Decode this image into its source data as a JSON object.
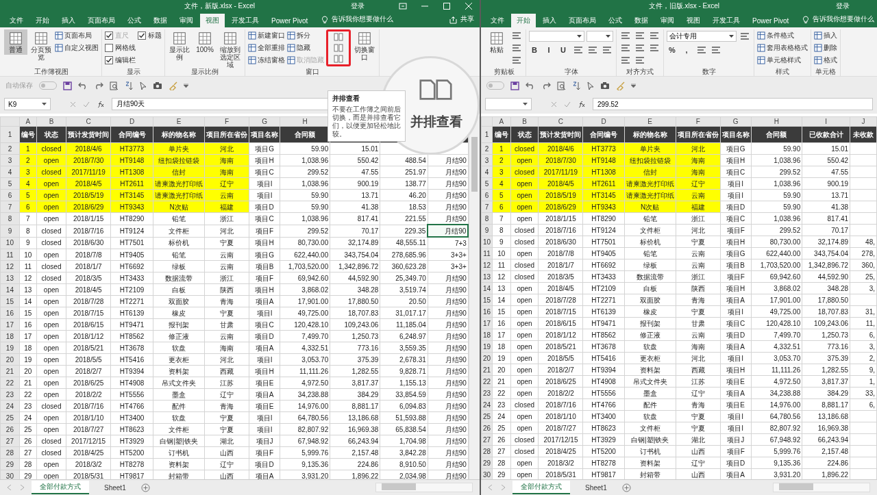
{
  "windows": [
    {
      "title": "文件，新版.xlsx  -  Excel",
      "sign_in": "登录",
      "window_controls": true,
      "tabs": [
        {
          "label": "文件",
          "selected": false
        },
        {
          "label": "开始",
          "selected": false
        },
        {
          "label": "插入",
          "selected": false
        },
        {
          "label": "页面布局",
          "selected": false
        },
        {
          "label": "公式",
          "selected": false
        },
        {
          "label": "数据",
          "selected": false
        },
        {
          "label": "审阅",
          "selected": false
        },
        {
          "label": "视图",
          "selected": true
        },
        {
          "label": "开发工具",
          "selected": false
        },
        {
          "label": "Power Pivot",
          "selected": false
        }
      ],
      "tell_me": "告诉我你想要做什么",
      "share": "共享",
      "ribbon": {
        "kind": "view",
        "groups": [
          {
            "label": "工作簿视图",
            "items": [
              {
                "kind": "large",
                "label": "普通",
                "selected": true
              },
              {
                "kind": "large",
                "label": "分页预览",
                "selected": false
              },
              {
                "kind": "small",
                "label": "页面布局",
                "disabled": false
              },
              {
                "kind": "small",
                "label": "自定义视图",
                "disabled": false
              }
            ]
          },
          {
            "label": "显示",
            "items": [
              {
                "kind": "check",
                "label": "直尺",
                "checked": true,
                "disabled": true
              },
              {
                "kind": "check",
                "label": "网格线",
                "checked": false,
                "disabled": false
              },
              {
                "kind": "check",
                "label": "编辑栏",
                "checked": true,
                "disabled": false
              },
              {
                "kind": "check",
                "label": "标题",
                "checked": true,
                "disabled": false
              }
            ]
          },
          {
            "label": "显示比例",
            "items": [
              {
                "kind": "large",
                "label": "显示比例"
              },
              {
                "kind": "large",
                "label": "100%"
              },
              {
                "kind": "large",
                "label": "缩放到选定区域"
              }
            ]
          },
          {
            "label": "窗口",
            "items": [
              {
                "kind": "small",
                "label": "新建窗口",
                "disabled": false
              },
              {
                "kind": "small",
                "label": "全部重排",
                "disabled": false
              },
              {
                "kind": "small",
                "label": "冻结窗格",
                "disabled": false
              },
              {
                "kind": "small",
                "label": "拆分",
                "disabled": false
              },
              {
                "kind": "small",
                "label": "隐藏",
                "disabled": false
              },
              {
                "kind": "small",
                "label": "取消隐藏",
                "disabled": true
              },
              {
                "kind": "stack",
                "framed": true,
                "items": [
                  {
                    "kind": "icon"
                  },
                  {
                    "kind": "icon"
                  },
                  {
                    "kind": "icon"
                  }
                ]
              },
              {
                "kind": "large",
                "label": "切换窗口"
              }
            ]
          }
        ]
      },
      "quick_access": {
        "autosave": "自动保存",
        "autosave_on": false
      },
      "name_box": "K9",
      "formula": "月结90天",
      "sheet": {
        "columns": [
          "A",
          "B",
          "C",
          "D",
          "E",
          "F",
          "G",
          "H"
        ],
        "header_row": "1",
        "headers": [
          "编号",
          "状态",
          "预计发货时间",
          "合同编号",
          "标的物名称",
          "项目所在省份",
          "项目名称",
          "合同额"
        ],
        "rows": [
          {
            "row": "2",
            "highlight": true,
            "selected": false,
            "cells": [
              "1",
              "closed",
              "2018/4/6",
              "HT3773",
              "单片夹",
              "河北",
              "项目G",
              "59.90",
              "15.01"
            ]
          },
          {
            "row": "3",
            "highlight": true,
            "selected": false,
            "cells": [
              "2",
              "open",
              "2018/7/30",
              "HT9148",
              "纽扣袋拉链袋",
              "海南",
              "项目H",
              "1,038.96",
              "550.42",
              "488.54",
              "月结90"
            ]
          },
          {
            "row": "4",
            "highlight": true,
            "selected": false,
            "cells": [
              "3",
              "closed",
              "2017/11/19",
              "HT1308",
              "信封",
              "海南",
              "项目C",
              "299.52",
              "47.55",
              "251.97",
              "月结90"
            ]
          },
          {
            "row": "5",
            "highlight": true,
            "selected": false,
            "cells": [
              "4",
              "open",
              "2018/4/5",
              "HT2611",
              "请柬激光打印纸",
              "辽宁",
              "项目I",
              "1,038.96",
              "900.19",
              "138.77",
              "月结90"
            ]
          },
          {
            "row": "6",
            "highlight": true,
            "selected": false,
            "cells": [
              "5",
              "open",
              "2018/5/19",
              "HT3145",
              "请柬激光打印纸",
              "云南",
              "项目I",
              "59.90",
              "13.71",
              "46.20",
              "月结90"
            ]
          },
          {
            "row": "7",
            "highlight": true,
            "selected": false,
            "cells": [
              "6",
              "open",
              "2018/6/29",
              "HT9343",
              "N次贴",
              "福建",
              "项目D",
              "59.90",
              "41.38",
              "18.53",
              "月结90"
            ]
          },
          {
            "row": "8",
            "highlight": false,
            "selected": false,
            "cells": [
              "7",
              "open",
              "2018/1/15",
              "HT8290",
              "铅笔",
              "浙江",
              "项目C",
              "1,038.96",
              "817.41",
              "221.55",
              "月结90"
            ]
          },
          {
            "row": "9",
            "highlight": false,
            "selected": true,
            "cells": [
              "8",
              "closed",
              "2018/7/16",
              "HT9124",
              "文件柜",
              "河北",
              "项目F",
              "299.52",
              "70.17",
              "229.35",
              "月结90"
            ]
          },
          {
            "row": "10",
            "highlight": false,
            "selected": false,
            "cells": [
              "9",
              "closed",
              "2018/6/30",
              "HT7501",
              "标价机",
              "宁夏",
              "项目H",
              "80,730.00",
              "32,174.89",
              "48,555.11",
              "7+3"
            ]
          },
          {
            "row": "11",
            "highlight": false,
            "selected": false,
            "cells": [
              "10",
              "open",
              "2018/7/8",
              "HT9405",
              "铅笔",
              "云南",
              "项目G",
              "622,440.00",
              "343,754.04",
              "278,685.96",
              "3+3+"
            ]
          },
          {
            "row": "12",
            "highlight": false,
            "selected": false,
            "cells": [
              "11",
              "closed",
              "2018/1/7",
              "HT6692",
              "绿板",
              "云南",
              "项目B",
              "1,703,520.00",
              "1,342,896.72",
              "360,623.28",
              "3+3+"
            ]
          },
          {
            "row": "13",
            "highlight": false,
            "selected": false,
            "cells": [
              "12",
              "closed",
              "2018/3/5",
              "HT3433",
              "数据流带",
              "浙江",
              "项目F",
              "69,942.60",
              "44,592.90",
              "25,349.70",
              "月结90"
            ]
          },
          {
            "row": "14",
            "highlight": false,
            "selected": false,
            "cells": [
              "13",
              "open",
              "2018/4/5",
              "HT2109",
              "白板",
              "陕西",
              "项目H",
              "3,868.02",
              "348.28",
              "3,519.74",
              "月结90"
            ]
          },
          {
            "row": "15",
            "highlight": false,
            "selected": false,
            "cells": [
              "14",
              "open",
              "2018/7/28",
              "HT2271",
              "双面胶",
              "青海",
              "项目A",
              "17,901.00",
              "17,880.50",
              "20.50",
              "月结90"
            ]
          },
          {
            "row": "16",
            "highlight": false,
            "selected": false,
            "cells": [
              "15",
              "open",
              "2018/7/15",
              "HT6139",
              "橡皮",
              "宁夏",
              "项目I",
              "49,725.00",
              "18,707.83",
              "31,017.17",
              "月结90"
            ]
          },
          {
            "row": "17",
            "highlight": false,
            "selected": false,
            "cells": [
              "16",
              "open",
              "2018/6/15",
              "HT9471",
              "报刊架",
              "甘肃",
              "项目C",
              "120,428.10",
              "109,243.06",
              "11,185.04",
              "月结90"
            ]
          },
          {
            "row": "18",
            "highlight": false,
            "selected": false,
            "cells": [
              "17",
              "open",
              "2018/1/12",
              "HT8562",
              "修正液",
              "云南",
              "项目D",
              "7,499.70",
              "1,250.73",
              "6,248.97",
              "月结90"
            ]
          },
          {
            "row": "19",
            "highlight": false,
            "selected": false,
            "cells": [
              "18",
              "open",
              "2018/5/21",
              "HT3678",
              "软盘",
              "海南",
              "项目A",
              "4,332.51",
              "773.16",
              "3,559.35",
              "月结90"
            ]
          },
          {
            "row": "20",
            "highlight": false,
            "selected": false,
            "cells": [
              "19",
              "open",
              "2018/5/5",
              "HT5416",
              "更衣柜",
              "河北",
              "项目I",
              "3,053.70",
              "375.39",
              "2,678.31",
              "月结90"
            ]
          },
          {
            "row": "21",
            "highlight": false,
            "selected": false,
            "cells": [
              "20",
              "open",
              "2018/2/7",
              "HT9394",
              "资料架",
              "西藏",
              "项目H",
              "11,111.26",
              "1,282.55",
              "9,828.71",
              "月结90"
            ]
          },
          {
            "row": "22",
            "highlight": false,
            "selected": false,
            "cells": [
              "21",
              "open",
              "2018/6/25",
              "HT4908",
              "吊式文件夹",
              "江苏",
              "项目E",
              "4,972.50",
              "3,817.37",
              "1,155.13",
              "月结90"
            ]
          },
          {
            "row": "23",
            "highlight": false,
            "selected": false,
            "cells": [
              "22",
              "open",
              "2018/2/2",
              "HT5556",
              "墨盒",
              "辽宁",
              "项目A",
              "34,238.88",
              "384.29",
              "33,854.59",
              "月结90"
            ]
          },
          {
            "row": "24",
            "highlight": false,
            "selected": false,
            "cells": [
              "23",
              "closed",
              "2018/7/16",
              "HT4766",
              "配件",
              "青海",
              "项目E",
              "14,976.00",
              "8,881.17",
              "6,094.83",
              "月结90"
            ]
          },
          {
            "row": "25",
            "highlight": false,
            "selected": false,
            "cells": [
              "24",
              "open",
              "2018/1/10",
              "HT3400",
              "软盘",
              "宁夏",
              "项目I",
              "64,780.56",
              "13,186.68",
              "51,593.88",
              "月结90"
            ]
          },
          {
            "row": "26",
            "highlight": false,
            "selected": false,
            "cells": [
              "25",
              "open",
              "2018/7/27",
              "HT8623",
              "文件柜",
              "宁夏",
              "项目I",
              "82,807.92",
              "16,969.38",
              "65,838.54",
              "月结90"
            ]
          },
          {
            "row": "27",
            "highlight": false,
            "selected": false,
            "cells": [
              "26",
              "closed",
              "2017/12/15",
              "HT3929",
              "白钢|塑|铁夹",
              "湖北",
              "项目J",
              "67,948.92",
              "66,243.94",
              "1,704.98",
              "月结90"
            ]
          },
          {
            "row": "28",
            "highlight": false,
            "selected": false,
            "cells": [
              "27",
              "closed",
              "2018/4/25",
              "HT5200",
              "订书机",
              "山西",
              "项目F",
              "5,999.76",
              "2,157.48",
              "3,842.28",
              "月结90"
            ]
          },
          {
            "row": "29",
            "highlight": false,
            "selected": false,
            "cells": [
              "28",
              "open",
              "2018/3/2",
              "HT8278",
              "资料架",
              "辽宁",
              "项目D",
              "9,135.36",
              "224.86",
              "8,910.50",
              "月结90"
            ]
          },
          {
            "row": "30",
            "highlight": false,
            "selected": false,
            "cells": [
              "29",
              "open",
              "2018/5/31",
              "HT9817",
              "封箱带",
              "山西",
              "项目A",
              "3,931.20",
              "1,896.22",
              "2,034.98",
              "月结90"
            ]
          }
        ]
      },
      "sheet_tabs": [
        {
          "label": "全部付款方式",
          "selected": true
        },
        {
          "label": "Sheet1",
          "selected": false
        }
      ]
    },
    {
      "title": "文件，旧版.xlsx  -  Excel",
      "sign_in": "登录",
      "window_controls": false,
      "tabs": [
        {
          "label": "文件",
          "selected": false
        },
        {
          "label": "开始",
          "selected": true
        },
        {
          "label": "插入",
          "selected": false
        },
        {
          "label": "页面布局",
          "selected": false
        },
        {
          "label": "公式",
          "selected": false
        },
        {
          "label": "数据",
          "selected": false
        },
        {
          "label": "审阅",
          "selected": false
        },
        {
          "label": "视图",
          "selected": false
        },
        {
          "label": "开发工具",
          "selected": false
        },
        {
          "label": "Power Pivot",
          "selected": false
        }
      ],
      "tell_me": "告诉我你想要做什么",
      "ribbon": {
        "kind": "home",
        "groups": [
          {
            "label": "剪贴板",
            "items": [
              {
                "kind": "large",
                "label": "粘贴"
              },
              {
                "kind": "icon"
              },
              {
                "kind": "icon"
              },
              {
                "kind": "icon"
              }
            ]
          },
          {
            "label": "字体",
            "items": [
              {
                "kind": "dropdown"
              },
              {
                "kind": "dropdown"
              },
              {
                "kind": "text",
                "label": "B"
              },
              {
                "kind": "text",
                "label": "I"
              },
              {
                "kind": "text",
                "label": "U"
              },
              {
                "kind": "icon"
              },
              {
                "kind": "icon"
              },
              {
                "kind": "icon"
              }
            ]
          },
          {
            "label": "对齐方式",
            "items": [
              {
                "kind": "icon"
              },
              {
                "kind": "icon"
              },
              {
                "kind": "icon"
              },
              {
                "kind": "icon"
              },
              {
                "kind": "icon"
              },
              {
                "kind": "icon"
              },
              {
                "kind": "icon"
              },
              {
                "kind": "icon"
              }
            ]
          },
          {
            "label": "数字",
            "items": [
              {
                "kind": "dropdown",
                "label": "会计专用"
              },
              {
                "kind": "icon"
              },
              {
                "kind": "text",
                "label": "%"
              },
              {
                "kind": "text",
                "label": ","
              },
              {
                "kind": "icon"
              },
              {
                "kind": "icon"
              }
            ]
          },
          {
            "label": "样式",
            "items": [
              {
                "kind": "small",
                "label": "条件格式",
                "disabled": false
              },
              {
                "kind": "small",
                "label": "套用表格格式",
                "disabled": false
              },
              {
                "kind": "small",
                "label": "单元格样式",
                "disabled": false
              }
            ]
          },
          {
            "label": "单元格",
            "items": [
              {
                "kind": "small",
                "label": "插入",
                "disabled": false
              },
              {
                "kind": "small",
                "label": "删除",
                "disabled": false
              },
              {
                "kind": "small",
                "label": "格式",
                "disabled": false
              }
            ]
          }
        ]
      },
      "quick_access": {
        "autosave_on": false
      },
      "formula": "299.52",
      "sheet": {
        "columns": [
          "A",
          "B",
          "C",
          "D",
          "E",
          "F",
          "G",
          "H",
          "I",
          "J"
        ],
        "header_row": "1",
        "headers": [
          "编号",
          "状态",
          "预计发货时间",
          "合同编号",
          "标的物名称",
          "项目所在省份",
          "项目名称",
          "合同额",
          "已收款合计",
          "未收款"
        ],
        "rows": [
          {
            "row": "2",
            "highlight": true,
            "cells": [
              "1",
              "closed",
              "2018/4/6",
              "HT3773",
              "单片夹",
              "河北",
              "项目G",
              "59.90",
              "15.01"
            ]
          },
          {
            "row": "3",
            "highlight": true,
            "cells": [
              "2",
              "open",
              "2018/7/30",
              "HT9148",
              "纽扣袋拉链袋",
              "海南",
              "项目H",
              "1,038.96",
              "550.42"
            ]
          },
          {
            "row": "4",
            "highlight": true,
            "cells": [
              "3",
              "closed",
              "2017/11/19",
              "HT1308",
              "信封",
              "海南",
              "项目C",
              "299.52",
              "47.55"
            ]
          },
          {
            "row": "5",
            "highlight": true,
            "cells": [
              "4",
              "open",
              "2018/4/5",
              "HT2611",
              "请柬激光打印纸",
              "辽宁",
              "项目I",
              "1,038.96",
              "900.19"
            ]
          },
          {
            "row": "6",
            "highlight": true,
            "cells": [
              "5",
              "open",
              "2018/5/19",
              "HT3145",
              "请柬激光打印纸",
              "云南",
              "项目I",
              "59.90",
              "13.71"
            ]
          },
          {
            "row": "7",
            "highlight": true,
            "cells": [
              "6",
              "open",
              "2018/6/29",
              "HT9343",
              "N次贴",
              "福建",
              "项目D",
              "59.90",
              "41.38"
            ]
          },
          {
            "row": "8",
            "highlight": false,
            "cells": [
              "7",
              "open",
              "2018/1/15",
              "HT8290",
              "铅笔",
              "浙江",
              "项目C",
              "1,038.96",
              "817.41"
            ]
          },
          {
            "row": "9",
            "highlight": false,
            "cells": [
              "8",
              "closed",
              "2018/7/16",
              "HT9124",
              "文件柜",
              "河北",
              "项目F",
              "299.52",
              "70.17"
            ]
          },
          {
            "row": "10",
            "highlight": false,
            "cells": [
              "9",
              "closed",
              "2018/6/30",
              "HT7501",
              "标价机",
              "宁夏",
              "项目H",
              "80,730.00",
              "32,174.89",
              "48,"
            ]
          },
          {
            "row": "11",
            "highlight": false,
            "cells": [
              "10",
              "open",
              "2018/7/8",
              "HT9405",
              "铅笔",
              "云南",
              "项目G",
              "622,440.00",
              "343,754.04",
              "278,"
            ]
          },
          {
            "row": "12",
            "highlight": false,
            "cells": [
              "11",
              "closed",
              "2018/1/7",
              "HT6692",
              "绿板",
              "云南",
              "项目B",
              "1,703,520.00",
              "1,342,896.72",
              "360,"
            ]
          },
          {
            "row": "13",
            "highlight": false,
            "cells": [
              "12",
              "closed",
              "2018/3/5",
              "HT3433",
              "数据流带",
              "浙江",
              "项目F",
              "69,942.60",
              "44,592.90",
              "25,"
            ]
          },
          {
            "row": "14",
            "highlight": false,
            "cells": [
              "13",
              "open",
              "2018/4/5",
              "HT2109",
              "白板",
              "陕西",
              "项目H",
              "3,868.02",
              "348.28",
              "3,"
            ]
          },
          {
            "row": "15",
            "highlight": false,
            "cells": [
              "14",
              "open",
              "2018/7/28",
              "HT2271",
              "双面胶",
              "青海",
              "项目A",
              "17,901.00",
              "17,880.50"
            ]
          },
          {
            "row": "16",
            "highlight": false,
            "cells": [
              "15",
              "open",
              "2018/7/15",
              "HT6139",
              "橡皮",
              "宁夏",
              "项目I",
              "49,725.00",
              "18,707.83",
              "31,"
            ]
          },
          {
            "row": "17",
            "highlight": false,
            "cells": [
              "16",
              "open",
              "2018/6/15",
              "HT9471",
              "报刊架",
              "甘肃",
              "项目C",
              "120,428.10",
              "109,243.06",
              "11,"
            ]
          },
          {
            "row": "18",
            "highlight": false,
            "cells": [
              "17",
              "open",
              "2018/1/12",
              "HT8562",
              "修正液",
              "云南",
              "项目D",
              "7,499.70",
              "1,250.73",
              "6,"
            ]
          },
          {
            "row": "19",
            "highlight": false,
            "cells": [
              "18",
              "open",
              "2018/5/21",
              "HT3678",
              "软盘",
              "海南",
              "项目A",
              "4,332.51",
              "773.16",
              "3,"
            ]
          },
          {
            "row": "20",
            "highlight": false,
            "cells": [
              "19",
              "open",
              "2018/5/5",
              "HT5416",
              "更衣柜",
              "河北",
              "项目I",
              "3,053.70",
              "375.39",
              "2,"
            ]
          },
          {
            "row": "21",
            "highlight": false,
            "cells": [
              "20",
              "open",
              "2018/2/7",
              "HT9394",
              "资料架",
              "西藏",
              "项目H",
              "11,111.26",
              "1,282.55",
              "9,"
            ]
          },
          {
            "row": "22",
            "highlight": false,
            "cells": [
              "21",
              "open",
              "2018/6/25",
              "HT4908",
              "吊式文件夹",
              "江苏",
              "项目E",
              "4,972.50",
              "3,817.37",
              "1,"
            ]
          },
          {
            "row": "23",
            "highlight": false,
            "cells": [
              "22",
              "open",
              "2018/2/2",
              "HT5556",
              "墨盒",
              "辽宁",
              "项目A",
              "34,238.88",
              "384.29",
              "33,"
            ]
          },
          {
            "row": "24",
            "highlight": false,
            "cells": [
              "23",
              "closed",
              "2018/7/16",
              "HT4766",
              "配件",
              "青海",
              "项目E",
              "14,976.00",
              "8,881.17",
              "6,"
            ]
          },
          {
            "row": "25",
            "highlight": false,
            "cells": [
              "24",
              "open",
              "2018/1/10",
              "HT3400",
              "软盘",
              "宁夏",
              "项目I",
              "64,780.56",
              "13,186.68"
            ]
          },
          {
            "row": "26",
            "highlight": false,
            "cells": [
              "25",
              "open",
              "2018/7/27",
              "HT8623",
              "文件柜",
              "宁夏",
              "项目I",
              "82,807.92",
              "16,969.38"
            ]
          },
          {
            "row": "27",
            "highlight": false,
            "cells": [
              "26",
              "closed",
              "2017/12/15",
              "HT3929",
              "白钢|塑|铁夹",
              "湖北",
              "项目J",
              "67,948.92",
              "66,243.94"
            ]
          },
          {
            "row": "28",
            "highlight": false,
            "cells": [
              "27",
              "closed",
              "2018/4/25",
              "HT5200",
              "订书机",
              "山西",
              "项目F",
              "5,999.76",
              "2,157.48"
            ]
          },
          {
            "row": "29",
            "highlight": false,
            "cells": [
              "28",
              "open",
              "2018/3/2",
              "HT8278",
              "资料架",
              "辽宁",
              "项目D",
              "9,135.36",
              "224.86"
            ]
          },
          {
            "row": "30",
            "highlight": false,
            "cells": [
              "29",
              "open",
              "2018/5/31",
              "HT9817",
              "封箱带",
              "山西",
              "项目A",
              "3,931.20",
              "1,896.22"
            ]
          }
        ]
      },
      "sheet_tabs": [
        {
          "label": "全部付款方式",
          "selected": true
        },
        {
          "label": "Sheet1",
          "selected": false
        }
      ]
    }
  ],
  "tooltip": {
    "title": "并排查看",
    "text": "不要在工作簿之间前后切换，而是并排查看它们，以便更加轻松地比较。"
  },
  "magnifier": {
    "label": "并排查看"
  }
}
